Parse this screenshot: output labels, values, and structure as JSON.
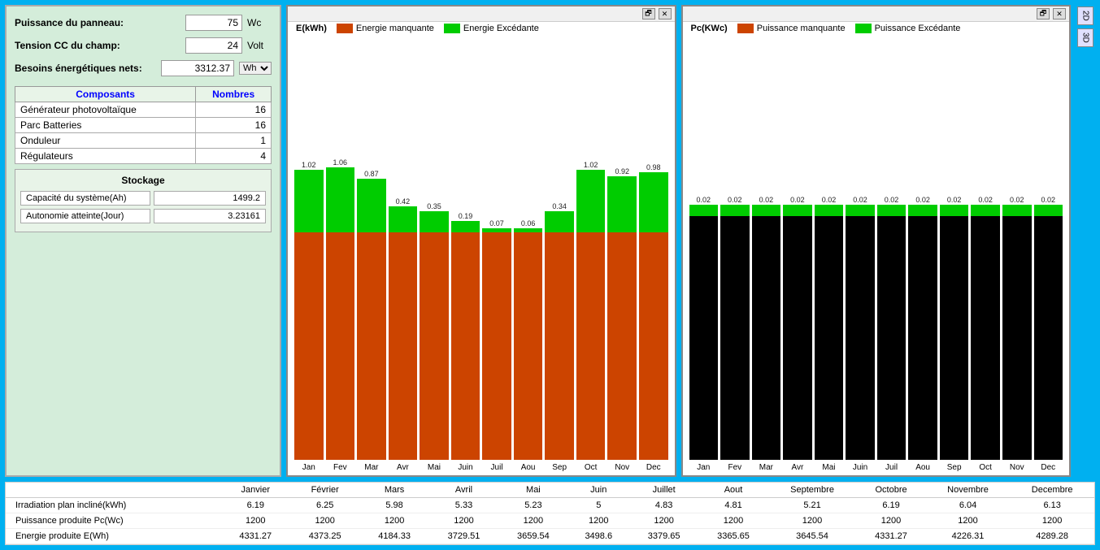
{
  "left_panel": {
    "puissance_label": "Puissance du panneau:",
    "puissance_value": "75",
    "puissance_unit": "Wc",
    "tension_label": "Tension CC du champ:",
    "tension_value": "24",
    "tension_unit": "Volt",
    "besoins_label": "Besoins énergétiques nets:",
    "besoins_value": "3312.37",
    "besoins_unit": "Wh",
    "table": {
      "col1": "Composants",
      "col2": "Nombres",
      "rows": [
        {
          "name": "Générateur photovoltaïque",
          "value": "16"
        },
        {
          "name": "Parc Batteries",
          "value": "16"
        },
        {
          "name": "Onduleur",
          "value": "1"
        },
        {
          "name": "Régulateurs",
          "value": "4"
        }
      ]
    },
    "stockage": {
      "title": "Stockage",
      "capacite_label": "Capacité du système(Ah)",
      "capacite_value": "1499.2",
      "autonomie_label": "Autonomie atteinte(Jour)",
      "autonomie_value": "3.23161"
    }
  },
  "chart1": {
    "title": "E(kWh)",
    "legend_red": "Energie manquante",
    "legend_green": "Energie Excédante",
    "months": [
      "Jan",
      "Fev",
      "Mar",
      "Avr",
      "Mai",
      "Juin",
      "Juil",
      "Aou",
      "Sep",
      "Oct",
      "Nov",
      "Dec"
    ],
    "green_values": [
      1.02,
      1.06,
      0.87,
      0.42,
      0.35,
      0.19,
      0.07,
      0.06,
      0.34,
      1.02,
      0.92,
      0.98
    ],
    "orange_base": 100,
    "bar_total_height": 340,
    "min_btn": "🗗",
    "close_btn": "✕"
  },
  "chart2": {
    "title": "Pc(KWc)",
    "legend_red": "Puissance manquante",
    "legend_green": "Puissance Excédante",
    "months": [
      "Jan",
      "Fev",
      "Mar",
      "Avr",
      "Mai",
      "Juin",
      "Juil",
      "Aou",
      "Sep",
      "Oct",
      "Nov",
      "Dec"
    ],
    "green_values": [
      0.02,
      0.02,
      0.02,
      0.02,
      0.02,
      0.02,
      0.02,
      0.02,
      0.02,
      0.02,
      0.02,
      0.02
    ],
    "min_btn": "🗗",
    "close_btn": "✕"
  },
  "bottom_table": {
    "headers": [
      "",
      "Janvier",
      "Février",
      "Mars",
      "Avril",
      "Mai",
      "Juin",
      "Juillet",
      "Aout",
      "Septembre",
      "Octobre",
      "Novembre",
      "Decembre"
    ],
    "rows": [
      {
        "label": "Irradiation plan incliné(kWh)",
        "values": [
          "6.19",
          "6.25",
          "5.98",
          "5.33",
          "5.23",
          "5",
          "4.83",
          "4.81",
          "5.21",
          "6.19",
          "6.04",
          "6.13"
        ]
      },
      {
        "label": "Puissance produite Pc(Wc)",
        "values": [
          "1200",
          "1200",
          "1200",
          "1200",
          "1200",
          "1200",
          "1200",
          "1200",
          "1200",
          "1200",
          "1200",
          "1200"
        ]
      },
      {
        "label": "Energie produite E(Wh)",
        "values": [
          "4331.27",
          "4373.25",
          "4184.33",
          "3729.51",
          "3659.54",
          "3498.6",
          "3379.65",
          "3365.65",
          "3645.54",
          "4331.27",
          "4226.31",
          "4289.28"
        ]
      }
    ]
  },
  "side_buttons": {
    "btn1": "2D",
    "btn2": "3D"
  }
}
